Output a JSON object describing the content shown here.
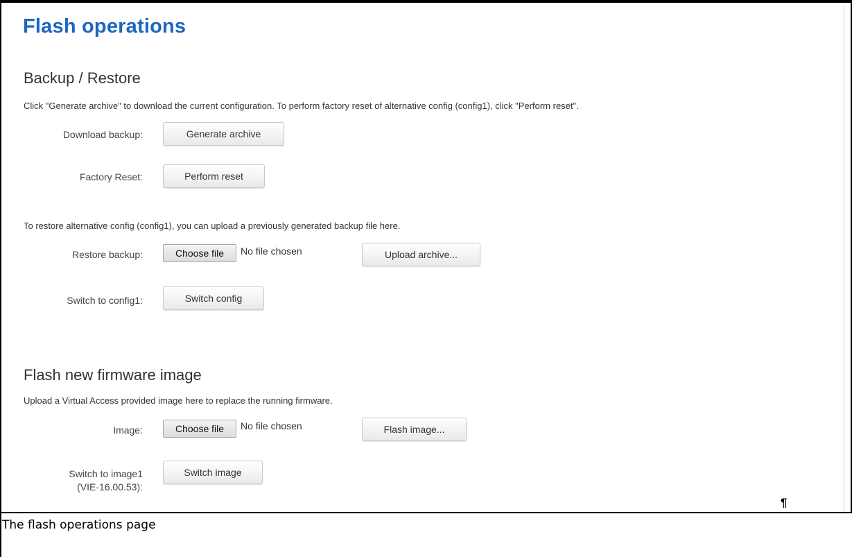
{
  "page": {
    "title": "Flash operations"
  },
  "backup_restore": {
    "heading": "Backup / Restore",
    "description": "Click \"Generate archive\" to download the current configuration. To perform factory reset of alternative config (config1), click \"Perform reset\".",
    "download_label": "Download backup:",
    "generate_button": "Generate archive",
    "factory_label": "Factory Reset:",
    "reset_button": "Perform reset",
    "restore_description": "To restore alternative config (config1), you can upload a previously generated backup file here.",
    "restore_label": "Restore backup:",
    "choose_file_button": "Choose file",
    "file_status": "No file chosen",
    "upload_button": "Upload archive...",
    "switch_label": "Switch to config1:",
    "switch_button": "Switch config"
  },
  "firmware": {
    "heading": "Flash new firmware image",
    "description": "Upload a Virtual Access provided image here to replace the running firmware.",
    "image_label": "Image:",
    "choose_file_button": "Choose file",
    "file_status": "No file chosen",
    "flash_button": "Flash image...",
    "switch_label_line1": "Switch to image1",
    "switch_label_line2": "(VIE-16.00.53):",
    "switch_button": "Switch image"
  },
  "document": {
    "pilcrow": "¶",
    "caption": "The flash operations page"
  }
}
